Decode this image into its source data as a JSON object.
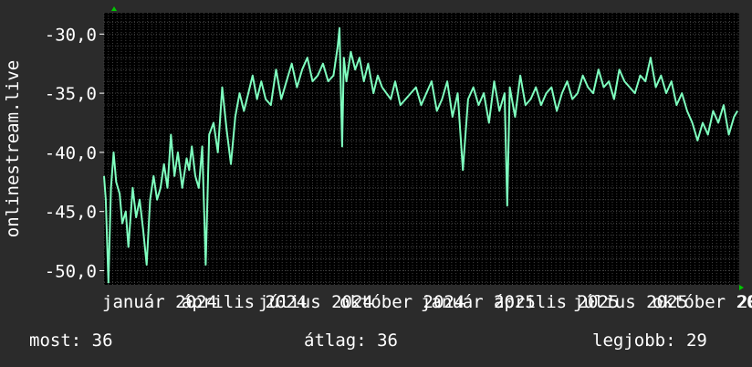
{
  "chart_data": {
    "type": "line",
    "ylabel": "onlinestream.live",
    "ylim": [
      -51.2,
      -28.2
    ],
    "yticks": [
      -30,
      -35,
      -40,
      -45,
      -50
    ],
    "ytick_labels": [
      "-30,0",
      "-35,0",
      "-40,0",
      "-45,0",
      "-50,0"
    ],
    "x_tick_labels": [
      "január 2024",
      "április 2024",
      "július 2024",
      "október 2024",
      "január 2025",
      "április 2025",
      "július 2025",
      "október 2025"
    ],
    "x_tick_label_tail": "20",
    "xlim": [
      "2023-12-31",
      "2025-12-31"
    ],
    "grid": true,
    "colors": {
      "background": "#2b2b2b",
      "plot_bg": "#000000",
      "grid": "#404040",
      "line": "#7fffbf",
      "axis_marker": "#00c800",
      "text": "#ffffff"
    },
    "series": [
      {
        "x": [
          "2023-12-31",
          "2024-01-02",
          "2024-01-05",
          "2024-01-08",
          "2024-01-11",
          "2024-01-14",
          "2024-01-18",
          "2024-01-21",
          "2024-01-25",
          "2024-01-28",
          "2024-02-02",
          "2024-02-06",
          "2024-02-10",
          "2024-02-14",
          "2024-02-18",
          "2024-02-22",
          "2024-02-26",
          "2024-03-01",
          "2024-03-05",
          "2024-03-09",
          "2024-03-13",
          "2024-03-17",
          "2024-03-21",
          "2024-03-25",
          "2024-03-30",
          "2024-04-04",
          "2024-04-07",
          "2024-04-10",
          "2024-04-14",
          "2024-04-18",
          "2024-04-22",
          "2024-04-26",
          "2024-04-30",
          "2024-05-05",
          "2024-05-10",
          "2024-05-15",
          "2024-05-20",
          "2024-05-25",
          "2024-05-30",
          "2024-06-04",
          "2024-06-09",
          "2024-06-14",
          "2024-06-19",
          "2024-06-24",
          "2024-06-29",
          "2024-07-04",
          "2024-07-10",
          "2024-07-16",
          "2024-07-22",
          "2024-07-28",
          "2024-08-03",
          "2024-08-09",
          "2024-08-15",
          "2024-08-21",
          "2024-08-27",
          "2024-09-02",
          "2024-09-08",
          "2024-09-14",
          "2024-09-20",
          "2024-09-25",
          "2024-09-27",
          "2024-09-30",
          "2024-10-02",
          "2024-10-05",
          "2024-10-10",
          "2024-10-15",
          "2024-10-20",
          "2024-10-25",
          "2024-10-30",
          "2024-11-05",
          "2024-11-10",
          "2024-11-15",
          "2024-11-20",
          "2024-11-25",
          "2024-11-30",
          "2024-12-06",
          "2024-12-12",
          "2024-12-18",
          "2024-12-24",
          "2024-12-30",
          "2025-01-05",
          "2025-01-11",
          "2025-01-17",
          "2025-01-23",
          "2025-01-29",
          "2025-02-04",
          "2025-02-10",
          "2025-02-16",
          "2025-02-22",
          "2025-02-28",
          "2025-03-06",
          "2025-03-12",
          "2025-03-18",
          "2025-03-24",
          "2025-03-30",
          "2025-04-05",
          "2025-04-08",
          "2025-04-11",
          "2025-04-17",
          "2025-04-23",
          "2025-04-29",
          "2025-05-05",
          "2025-05-11",
          "2025-05-17",
          "2025-05-23",
          "2025-05-29",
          "2025-06-04",
          "2025-06-10",
          "2025-06-16",
          "2025-06-22",
          "2025-06-28",
          "2025-07-04",
          "2025-07-10",
          "2025-07-16",
          "2025-07-22",
          "2025-07-28",
          "2025-08-03",
          "2025-08-09",
          "2025-08-15",
          "2025-08-21",
          "2025-08-27",
          "2025-09-02",
          "2025-09-08",
          "2025-09-14",
          "2025-09-20",
          "2025-09-26",
          "2025-10-02",
          "2025-10-08",
          "2025-10-14",
          "2025-10-20",
          "2025-10-26",
          "2025-11-01",
          "2025-11-07",
          "2025-11-13",
          "2025-11-19",
          "2025-11-25",
          "2025-12-01",
          "2025-12-07",
          "2025-12-13",
          "2025-12-19",
          "2025-12-25",
          "2025-12-29"
        ],
        "y": [
          -42.0,
          -44.0,
          -51.0,
          -43.0,
          -40.0,
          -42.5,
          -43.5,
          -46.0,
          -45.0,
          -48.0,
          -43.0,
          -45.5,
          -44.0,
          -46.5,
          -49.5,
          -44.0,
          -42.0,
          -44.0,
          -43.0,
          -41.0,
          -43.0,
          -38.5,
          -42.0,
          -40.0,
          -43.0,
          -40.5,
          -41.5,
          -39.5,
          -42.0,
          -43.0,
          -39.5,
          -49.5,
          -38.5,
          -37.5,
          -40.0,
          -34.5,
          -38.0,
          -41.0,
          -37.0,
          -35.0,
          -36.5,
          -35.0,
          -33.5,
          -35.5,
          -34.0,
          -35.5,
          -36.0,
          -33.0,
          -35.5,
          -34.0,
          -32.5,
          -34.5,
          -33.0,
          -32.0,
          -34.0,
          -33.5,
          -32.5,
          -34.0,
          -33.5,
          -31.0,
          -29.5,
          -39.5,
          -32.0,
          -34.0,
          -31.5,
          -33.0,
          -32.0,
          -34.0,
          -32.5,
          -35.0,
          -33.5,
          -34.5,
          -35.0,
          -35.5,
          -34.0,
          -36.0,
          -35.5,
          -35.0,
          -34.5,
          -36.0,
          -35.0,
          -34.0,
          -36.5,
          -35.5,
          -34.0,
          -37.0,
          -35.0,
          -41.5,
          -35.5,
          -34.5,
          -36.0,
          -35.0,
          -37.5,
          -34.0,
          -36.5,
          -35.0,
          -44.5,
          -34.5,
          -37.0,
          -33.5,
          -36.0,
          -35.5,
          -34.5,
          -36.0,
          -35.0,
          -34.5,
          -36.5,
          -35.0,
          -34.0,
          -35.5,
          -35.0,
          -33.5,
          -34.5,
          -35.0,
          -33.0,
          -34.5,
          -34.0,
          -35.5,
          -33.0,
          -34.0,
          -34.5,
          -35.0,
          -33.5,
          -34.0,
          -32.0,
          -34.5,
          -33.5,
          -35.0,
          -34.0,
          -36.0,
          -35.0,
          -36.5,
          -37.5,
          -39.0,
          -37.5,
          -38.5,
          -36.5,
          -37.5,
          -36.0,
          -38.5,
          -37.0,
          -36.5
        ]
      }
    ]
  },
  "stats": {
    "now": "most: 36",
    "avg": "átlag: 36",
    "best": "legjobb: 29"
  }
}
